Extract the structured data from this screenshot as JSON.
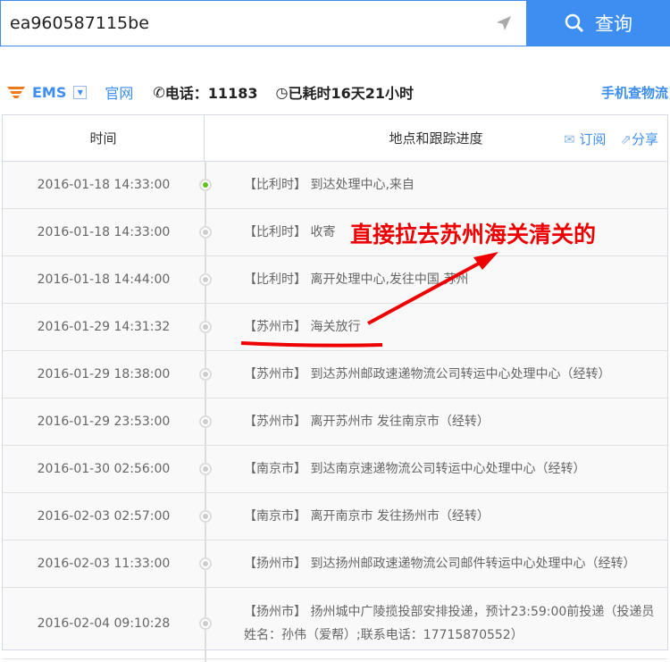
{
  "search": {
    "value": "ea960587115be",
    "button": "查询"
  },
  "info": {
    "carrier": "EMS",
    "official": "官网",
    "phone": "电话：11183",
    "elapsed": "已耗时16天21小时",
    "mobile": "手机查物流"
  },
  "table": {
    "col_time": "时间",
    "col_track": "地点和跟踪进度",
    "subscribe": "订阅",
    "share": "分享",
    "rows": [
      {
        "time": "2016-01-18 14:33:00",
        "desc": "【比利时】 到达处理中心,来自"
      },
      {
        "time": "2016-01-18 14:33:00",
        "desc": "【比利时】 收寄"
      },
      {
        "time": "2016-01-18 14:44:00",
        "desc": "【比利时】 离开处理中心,发往中国 苏州"
      },
      {
        "time": "2016-01-29 14:31:32",
        "desc": "【苏州市】 海关放行"
      },
      {
        "time": "2016-01-29 18:38:00",
        "desc": "【苏州市】 到达苏州邮政速递物流公司转运中心处理中心（经转）"
      },
      {
        "time": "2016-01-29 23:53:00",
        "desc": "【苏州市】 离开苏州市 发往南京市（经转）"
      },
      {
        "time": "2016-01-30 02:56:00",
        "desc": "【南京市】 到达南京速递物流公司转运中心处理中心（经转）"
      },
      {
        "time": "2016-02-03 02:57:00",
        "desc": "【南京市】 离开南京市 发往扬州市（经转）"
      },
      {
        "time": "2016-02-03 11:33:00",
        "desc": "【扬州市】 到达扬州邮政速递物流公司邮件转运中心处理中心（经转）"
      },
      {
        "time": "2016-02-04 09:10:28",
        "desc": "【扬州市】 扬州城中广陵揽投部安排投递，预计23:59:00前投递（投递员姓名：孙伟（爱帮）;联系电话：17715870552）"
      }
    ]
  },
  "annotation": "直接拉去苏州海关清关的",
  "colors": {
    "accent": "#3d8ef0",
    "annotation": "#e00000",
    "latest_dot": "#5fc31f"
  }
}
